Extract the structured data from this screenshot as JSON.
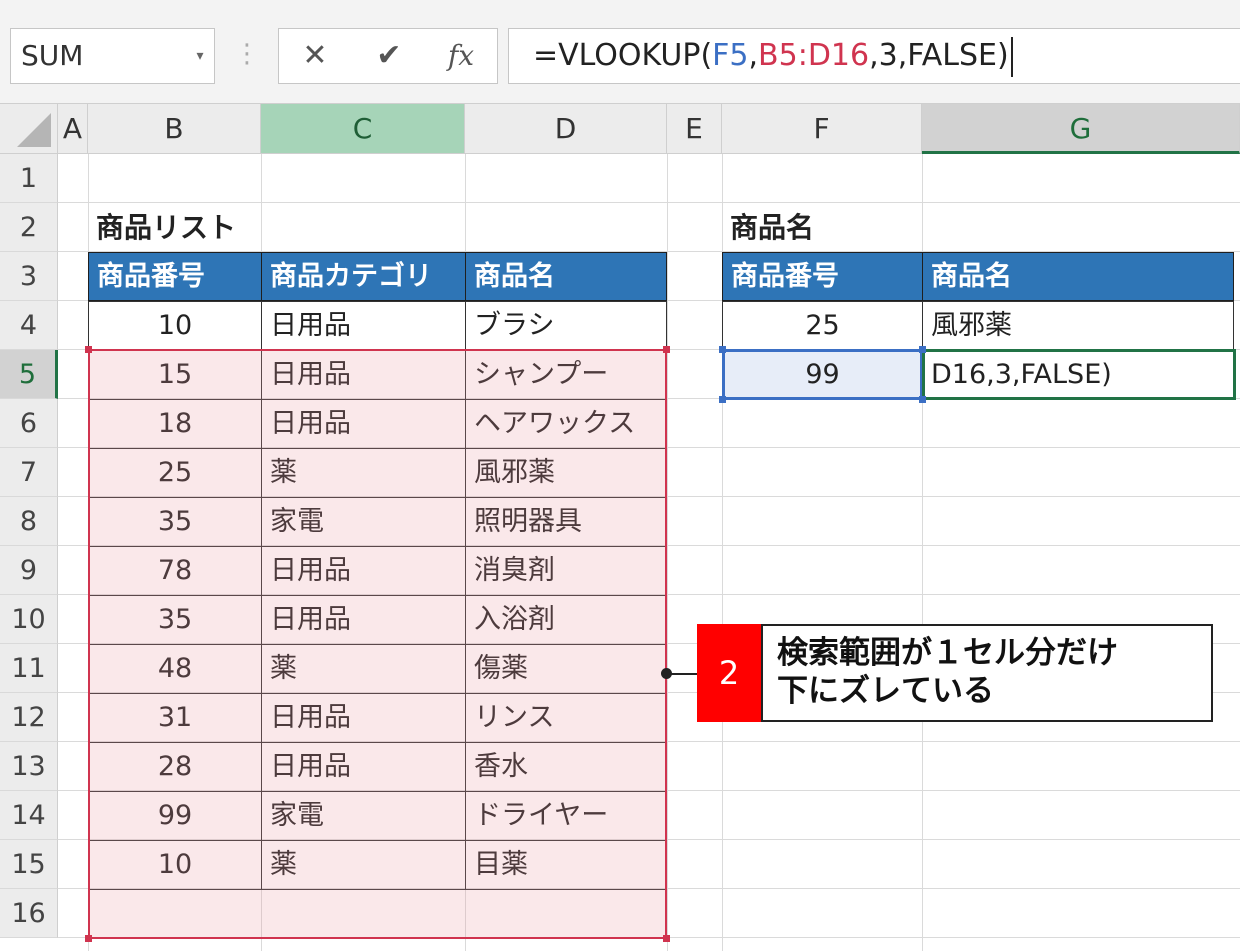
{
  "formula_bar": {
    "name_box": "SUM",
    "cancel_icon": "close-icon",
    "enter_icon": "check-icon",
    "fx_label": "fx",
    "formula_parts": [
      {
        "text": "=VLOOKUP(",
        "color": "#222222"
      },
      {
        "text": "F5",
        "color": "#3b6fc4"
      },
      {
        "text": ",",
        "color": "#222222"
      },
      {
        "text": "B5:D16",
        "color": "#d0344f"
      },
      {
        "text": ",3,FALSE)",
        "color": "#222222"
      }
    ]
  },
  "columns": [
    "A",
    "B",
    "C",
    "D",
    "E",
    "F",
    "G"
  ],
  "rows": [
    "1",
    "2",
    "3",
    "4",
    "5",
    "6",
    "7",
    "8",
    "9",
    "10",
    "11",
    "12",
    "13",
    "14",
    "15",
    "16"
  ],
  "product_list": {
    "title": "商品リスト",
    "headers": [
      "商品番号",
      "商品カテゴリ",
      "商品名"
    ],
    "rows": [
      {
        "num": "10",
        "category": "日用品",
        "name": "ブラシ"
      },
      {
        "num": "15",
        "category": "日用品",
        "name": "シャンプー"
      },
      {
        "num": "18",
        "category": "日用品",
        "name": "ヘアワックス"
      },
      {
        "num": "25",
        "category": "薬",
        "name": "風邪薬"
      },
      {
        "num": "35",
        "category": "家電",
        "name": "照明器具"
      },
      {
        "num": "78",
        "category": "日用品",
        "name": "消臭剤"
      },
      {
        "num": "35",
        "category": "日用品",
        "name": "入浴剤"
      },
      {
        "num": "48",
        "category": "薬",
        "name": "傷薬"
      },
      {
        "num": "31",
        "category": "日用品",
        "name": "リンス"
      },
      {
        "num": "28",
        "category": "日用品",
        "name": "香水"
      },
      {
        "num": "99",
        "category": "家電",
        "name": "ドライヤー"
      },
      {
        "num": "10",
        "category": "薬",
        "name": "目薬"
      }
    ]
  },
  "lookup": {
    "title": "商品名",
    "headers": [
      "商品番号",
      "商品名"
    ],
    "rows": [
      {
        "num": "25",
        "name": "風邪薬"
      },
      {
        "num": "99",
        "name": "D16,3,FALSE)"
      }
    ]
  },
  "callout": {
    "number": "2",
    "line1": "検索範囲が１セル分だけ",
    "line2": "下にズレている"
  },
  "colors": {
    "header_fill": "#2e75b6",
    "range_border": "#d0344f",
    "ref_blue": "#3b6fc4",
    "excel_green": "#217346"
  }
}
